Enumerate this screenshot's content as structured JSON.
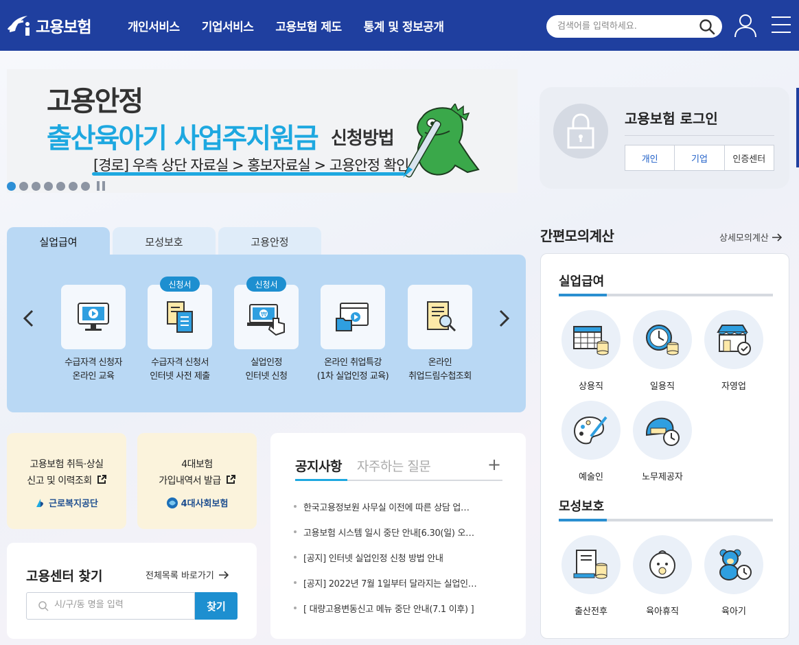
{
  "header": {
    "logo_text": "고용보험",
    "menu": [
      "개인서비스",
      "기업서비스",
      "고용보험 제도",
      "통계 및 정보공개"
    ],
    "search_placeholder": "검색어를 입력하세요."
  },
  "banner": {
    "line1": "고용안정",
    "line2": "출산육아기 사업주지원금",
    "line2b": "신청방법",
    "line3": "[경로] 우측 상단 자료실 > 홍보자료실 > 고용안정 확인",
    "slide_count": 7,
    "active_slide": 1
  },
  "login": {
    "title": "고용보험 로그인",
    "buttons": [
      "개인",
      "기업",
      "인증센터"
    ]
  },
  "service_tabs": {
    "tabs": [
      "실업급여",
      "모성보호",
      "고용안정"
    ],
    "active": 0,
    "items": [
      {
        "label1": "수급자격 신청자",
        "label2": "온라인 교육",
        "badge": "",
        "icon": "monitor-play-icon"
      },
      {
        "label1": "수급자격 신청서",
        "label2": "인터넷 사전 제출",
        "badge": "신청서",
        "icon": "documents-icon"
      },
      {
        "label1": "실업인정",
        "label2": "인터넷 신청",
        "badge": "신청서",
        "icon": "laptop-hand-icon"
      },
      {
        "label1": "온라인 취업특강",
        "label2": "(1차 실업인정 교육)",
        "badge": "",
        "icon": "video-folder-icon"
      },
      {
        "label1": "온라인",
        "label2": "취업드림수첩조회",
        "badge": "",
        "icon": "book-search-icon"
      }
    ]
  },
  "quick_cards": [
    {
      "line1": "고용보험 취득·상실",
      "line2": "신고 및 이력조회",
      "org": "근로복지공단"
    },
    {
      "line1": "4대보험",
      "line2": "가입내역서 발급",
      "org": "4대사회보험"
    }
  ],
  "notice": {
    "tabs": [
      "공지사항",
      "자주하는 질문"
    ],
    "plus": "+",
    "items": [
      "한국고용정보원 사무실 이전에 따른 상담 업…",
      "고용보험 시스템 일시 중단 안내[6.30(일) 오…",
      "[공지] 인터넷 실업인정 신청 방법 안내",
      "[공지] 2022년 7월 1일부터 달라지는 실업인…",
      "[ 대량고용변동신고 메뉴 중단 안내(7.1 이후) ]"
    ]
  },
  "finder": {
    "title": "고용센터 찾기",
    "link": "전체목록 바로가기",
    "placeholder": "시/구/동 명을 입력",
    "button": "찾기"
  },
  "calculator": {
    "title": "간편모의계산",
    "link": "상세모의계산",
    "section1": "실업급여",
    "section1_items": [
      "상용직",
      "일용직",
      "자영업",
      "예술인",
      "노무제공자"
    ],
    "section2": "모성보호",
    "section2_items": [
      "출산전후",
      "육아휴직",
      "육아기"
    ]
  }
}
